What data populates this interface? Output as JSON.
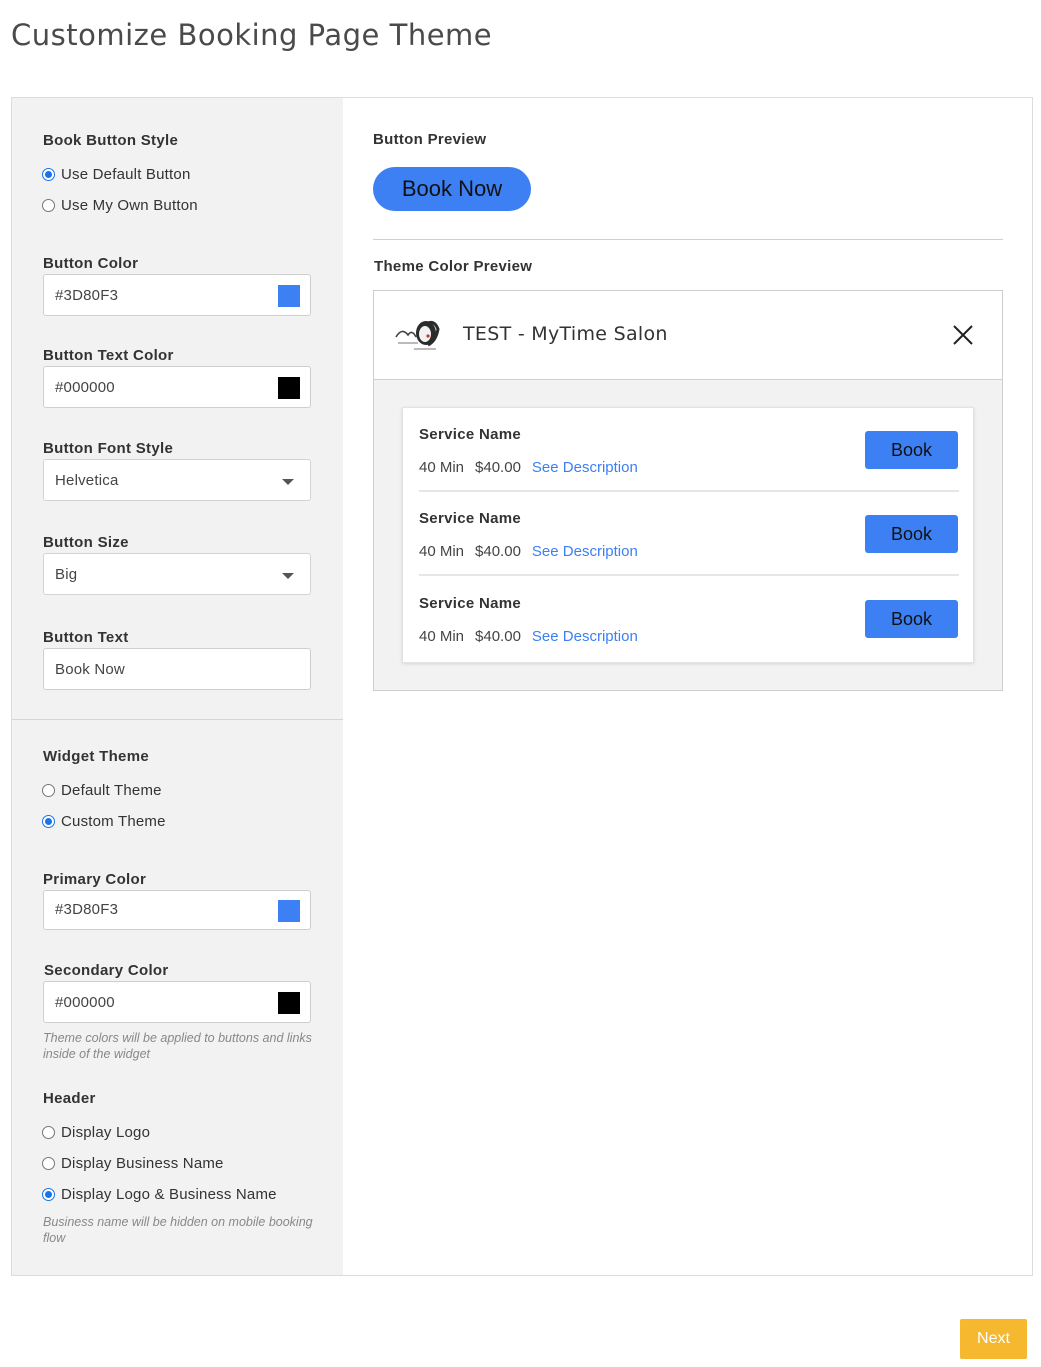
{
  "page": {
    "title": "Customize Booking Page Theme"
  },
  "colors": {
    "primary": "#3D80F3",
    "secondary": "#000000",
    "next_button": "#F5B82E"
  },
  "left": {
    "book_button_style": {
      "label": "Book Button Style",
      "options": [
        "Use Default Button",
        "Use My Own Button"
      ],
      "selected": "Use Default Button"
    },
    "button_color": {
      "label": "Button Color",
      "value": "#3D80F3"
    },
    "button_text_color": {
      "label": "Button Text Color",
      "value": "#000000"
    },
    "button_font_style": {
      "label": "Button Font Style",
      "value": "Helvetica"
    },
    "button_size": {
      "label": "Button Size",
      "value": "Big"
    },
    "button_text": {
      "label": "Button Text",
      "value": "Book Now"
    },
    "widget_theme": {
      "label": "Widget Theme",
      "options": [
        "Default Theme",
        "Custom Theme"
      ],
      "selected": "Custom Theme"
    },
    "primary_color": {
      "label": "Primary Color",
      "value": "#3D80F3"
    },
    "secondary_color": {
      "label": "Secondary Color",
      "value": "#000000"
    },
    "theme_hint": "Theme colors will be applied to buttons and links inside of the widget",
    "header": {
      "label": "Header",
      "options": [
        "Display Logo",
        "Display Business Name",
        "Display Logo & Business Name"
      ],
      "selected": "Display Logo & Business Name"
    },
    "header_hint": "Business name will be hidden on mobile booking flow"
  },
  "right": {
    "button_preview_label": "Button Preview",
    "preview_button_text": "Book Now",
    "theme_preview_label": "Theme Color Preview",
    "widget": {
      "business_name": "TEST - MyTime Salon",
      "logo_icon": "salon-logo-icon",
      "close_icon": "close-icon",
      "services": [
        {
          "name": "Service Name",
          "duration": "40 Min",
          "price": "$40.00",
          "link": "See Description",
          "button": "Book"
        },
        {
          "name": "Service Name",
          "duration": "40 Min",
          "price": "$40.00",
          "link": "See Description",
          "button": "Book"
        },
        {
          "name": "Service Name",
          "duration": "40 Min",
          "price": "$40.00",
          "link": "See Description",
          "button": "Book"
        }
      ]
    }
  },
  "footer": {
    "next_label": "Next"
  }
}
